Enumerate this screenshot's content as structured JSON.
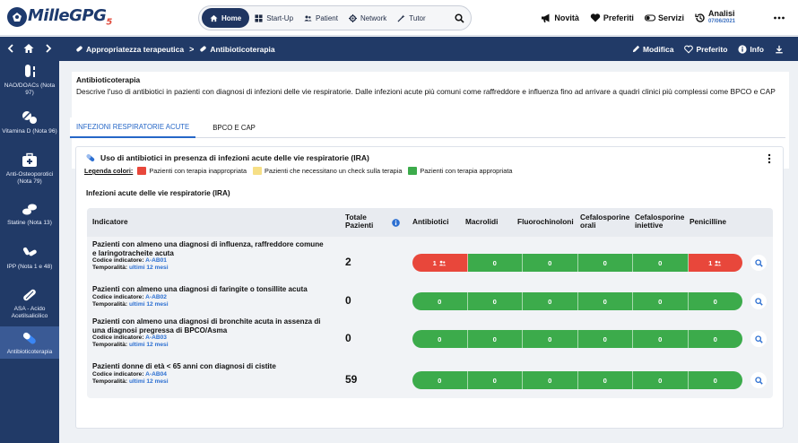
{
  "app": {
    "logo_text_main": "Mille",
    "logo_text_accent": "GPG",
    "logo_suffix": "5"
  },
  "mainnav": {
    "items": [
      {
        "label": "Home",
        "icon": "home-icon",
        "active": true
      },
      {
        "label": "Start-Up",
        "icon": "grid-icon"
      },
      {
        "label": "Patient",
        "icon": "users-icon"
      },
      {
        "label": "Network",
        "icon": "network-icon"
      },
      {
        "label": "Tutor",
        "icon": "wand-icon"
      }
    ],
    "search_icon": "search-icon"
  },
  "rightnav": {
    "novita": "Novità",
    "preferiti": "Preferiti",
    "servizi": "Servizi",
    "analisi": "Analisi",
    "analisi_date": "07/06/2021"
  },
  "breadcrumb": {
    "items": [
      "Appropriatezza terapeutica",
      "Antibioticoterapia"
    ],
    "separator": ">"
  },
  "actions": {
    "modifica": "Modifica",
    "preferito": "Preferito",
    "info": "Info"
  },
  "sidebar": {
    "items": [
      {
        "label": "NAO/DOACs (Nota 97)",
        "icon": "vial-icon"
      },
      {
        "label": "Vitamina D (Nota 96)",
        "icon": "pills-icon"
      },
      {
        "label": "Anti-Osteoporotici (Nota 79)",
        "icon": "medkit-icon"
      },
      {
        "label": "Statine (Nota 13)",
        "icon": "tablets-icon"
      },
      {
        "label": "IPP (Nota 1 e 48)",
        "icon": "capsules-icon"
      },
      {
        "label": "ASA - Acido Acetilsalicilico",
        "icon": "pill-icon"
      },
      {
        "label": "Antibioticoterapia",
        "icon": "capsule-icon",
        "active": true
      }
    ]
  },
  "description": {
    "title": "Antibioticoterapia",
    "text": "Descrive l'uso di antibiotici in pazienti con diagnosi di infezioni delle vie respiratorie. Dalle infezioni acute più comuni come raffreddore e influenza fino ad arrivare a quadri clinici più complessi come BPCO e CAP"
  },
  "tabs": [
    {
      "label": "INFEZIONI RESPIRATORIE ACUTE",
      "active": true
    },
    {
      "label": "BPCO E CAP",
      "active": false
    }
  ],
  "card": {
    "title": "Uso di antibiotici in presenza di infezioni acute delle vie respiratorie (IRA)",
    "legend_title": "Legenda colori:",
    "legend": [
      {
        "color": "#e8473b",
        "label": "Pazienti con terapia inappropriata"
      },
      {
        "color": "#f6df86",
        "label": "Pazienti che necessitano un check sulla terapia"
      },
      {
        "color": "#3cab4b",
        "label": "Pazienti con terapia appropriata"
      }
    ],
    "subtitle": "Infezioni acute delle vie respiratorie (IRA)"
  },
  "table": {
    "headers": {
      "indicatore": "Indicatore",
      "totale": "Totale Pazienti",
      "columns": [
        "Antibiotici",
        "Macrolidi",
        "Fluorochinoloni",
        "Cefalosporine orali",
        "Cefalosporine iniettive",
        "Penicilline"
      ]
    },
    "code_label": "Codice indicatore:",
    "time_label": "Temporalità:",
    "rows": [
      {
        "title": "Pazienti con almeno una diagnosi di influenza, raffreddore comune e laringotracheite acuta",
        "code": "A-AB01",
        "time": "ultimi 12 mesi",
        "total": "2",
        "cells": [
          {
            "value": "1",
            "status": "red",
            "icon": "users-icon"
          },
          {
            "value": "0",
            "status": "green"
          },
          {
            "value": "0",
            "status": "green"
          },
          {
            "value": "0",
            "status": "green"
          },
          {
            "value": "0",
            "status": "green"
          },
          {
            "value": "1",
            "status": "red",
            "icon": "users-icon"
          }
        ]
      },
      {
        "title": "Pazienti con almeno una diagnosi di faringite o tonsillite acuta",
        "code": "A-AB02",
        "time": "ultimi 12 mesi",
        "total": "0",
        "cells": [
          {
            "value": "0",
            "status": "green"
          },
          {
            "value": "0",
            "status": "green"
          },
          {
            "value": "0",
            "status": "green"
          },
          {
            "value": "0",
            "status": "green"
          },
          {
            "value": "0",
            "status": "green"
          },
          {
            "value": "0",
            "status": "green"
          }
        ]
      },
      {
        "title": "Pazienti con almeno una diagnosi di bronchite acuta in assenza di una diagnosi pregressa di BPCO/Asma",
        "code": "A-AB03",
        "time": "ultimi 12 mesi",
        "total": "0",
        "cells": [
          {
            "value": "0",
            "status": "green"
          },
          {
            "value": "0",
            "status": "green"
          },
          {
            "value": "0",
            "status": "green"
          },
          {
            "value": "0",
            "status": "green"
          },
          {
            "value": "0",
            "status": "green"
          },
          {
            "value": "0",
            "status": "green"
          }
        ]
      },
      {
        "title": "Pazienti donne di età < 65 anni con diagnosi di cistite",
        "code": "A-AB04",
        "time": "ultimi 12 mesi",
        "total": "59",
        "cells": [
          {
            "value": "0",
            "status": "green"
          },
          {
            "value": "0",
            "status": "green"
          },
          {
            "value": "0",
            "status": "green"
          },
          {
            "value": "0",
            "status": "green"
          },
          {
            "value": "0",
            "status": "green"
          },
          {
            "value": "0",
            "status": "green"
          }
        ]
      }
    ]
  },
  "colors": {
    "navy": "#213a67",
    "red": "#e8473b",
    "green": "#3cab4b",
    "yellow": "#f6df86",
    "link": "#2c6fd1"
  }
}
